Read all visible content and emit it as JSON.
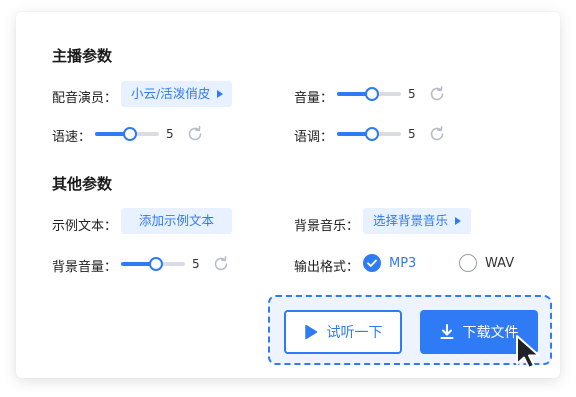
{
  "broadcast": {
    "title": "主播参数",
    "voice_label": "配音演员：",
    "voice_value": "小云/活泼俏皮",
    "volume_label": "音量：",
    "volume_value": "5",
    "speed_label": "语速：",
    "speed_value": "5",
    "pitch_label": "语调：",
    "pitch_value": "5"
  },
  "other": {
    "title": "其他参数",
    "sample_label": "示例文本：",
    "sample_button": "添加示例文本",
    "bgm_label": "背景音乐：",
    "bgm_button": "选择背景音乐",
    "bgm_volume_label": "背景音量：",
    "bgm_volume_value": "5",
    "format_label": "输出格式：",
    "format_options": [
      "MP3",
      "WAV"
    ],
    "format_selected": "MP3"
  },
  "slider_levels": {
    "volume": 0.55,
    "speed": 0.55,
    "pitch": 0.55,
    "bgm_volume": 0.55
  },
  "actions": {
    "preview": "试听一下",
    "download": "下载文件"
  },
  "icons": {
    "reset": "refresh-icon",
    "preview": "play-icon",
    "download": "download-icon",
    "cursor": "mouse-pointer-icon",
    "check": "check-icon",
    "dropdown": "caret-right-icon"
  },
  "colors": {
    "accent": "#2f7af5",
    "chip_bg": "#e8f1ff",
    "rail": "#d9dde3",
    "dash_box_bg": "#eef4ff"
  }
}
